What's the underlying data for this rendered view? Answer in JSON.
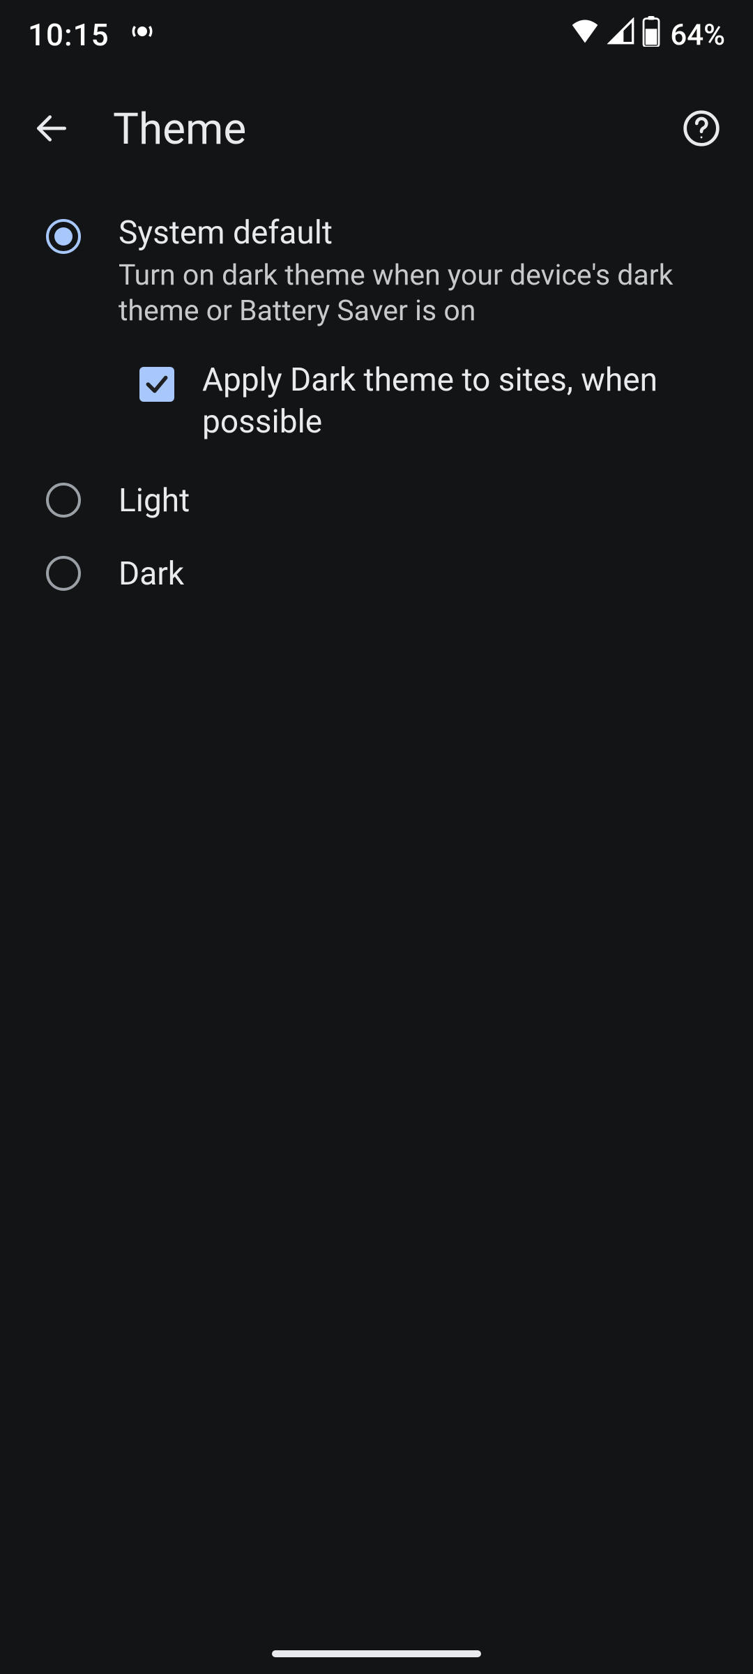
{
  "status": {
    "time": "10:15",
    "battery_text": "64%"
  },
  "appbar": {
    "title": "Theme"
  },
  "options": {
    "system_default": {
      "title": "System default",
      "desc": "Turn on dark theme when your device's dark theme or Battery Saver is on",
      "selected": true
    },
    "apply_dark_sites": {
      "label": "Apply Dark theme to sites, when possible",
      "checked": true
    },
    "light": {
      "title": "Light",
      "selected": false
    },
    "dark": {
      "title": "Dark",
      "selected": false
    }
  },
  "colors": {
    "accent": "#a8c7fa",
    "background": "#131416",
    "text_primary": "#e8eaed",
    "text_secondary": "#c7c9cc"
  }
}
